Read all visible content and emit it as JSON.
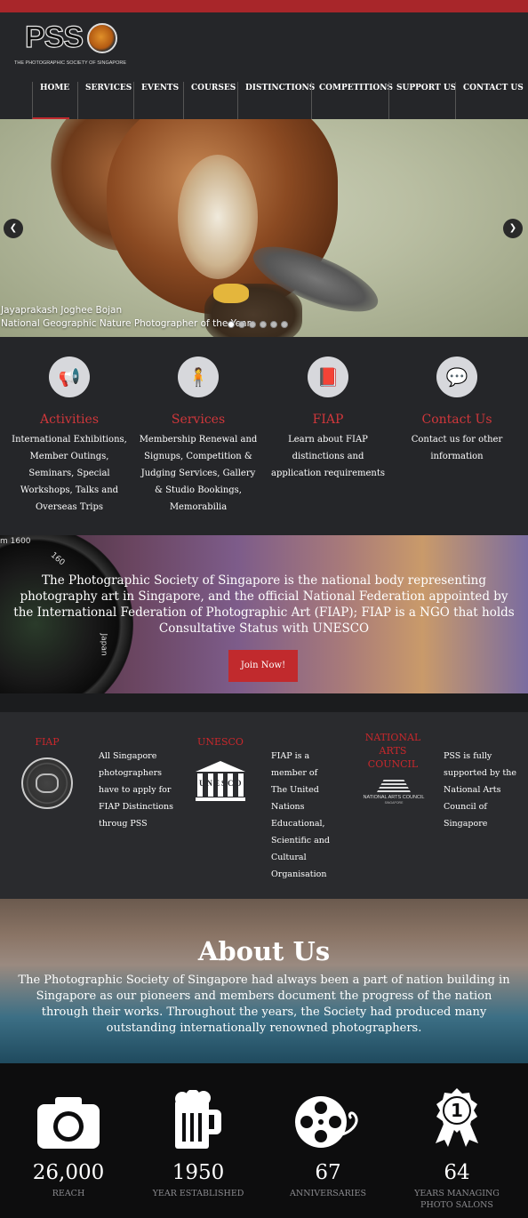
{
  "header": {
    "logo_text": "PSS",
    "logo_subtitle": "THE PHOTOGRAPHIC SOCIETY OF SINGAPORE",
    "nav": [
      {
        "label": "HOME",
        "active": true
      },
      {
        "label": "SERVICES",
        "active": false
      },
      {
        "label": "EVENTS",
        "active": false
      },
      {
        "label": "COURSES",
        "active": false
      },
      {
        "label": "DISTINCTIONS",
        "active": false
      },
      {
        "label": "COMPETITIONS",
        "active": false
      },
      {
        "label": "SUPPORT US",
        "active": false
      },
      {
        "label": "CONTACT US",
        "active": false
      }
    ]
  },
  "slider": {
    "caption_line1": "Jayaprakash Joghee Bojan",
    "caption_line2": "National Geographic Nature Photographer of the Year",
    "prev_icon": "chevron-left-icon",
    "next_icon": "chevron-right-icon",
    "slide_count": 6,
    "active_slide": 1
  },
  "features": [
    {
      "icon": "megaphone-icon",
      "glyph": "📢",
      "title": "Activities",
      "text": "International Exhibitions, Member Outings, Seminars, Special Workshops, Talks and Overseas Trips"
    },
    {
      "icon": "person-icon",
      "glyph": "🧍",
      "title": "Services",
      "text": "Membership Renewal and Signups, Competition & Judging Services, Gallery & Studio Bookings, Memorabilia"
    },
    {
      "icon": "book-icon",
      "glyph": "📕",
      "title": "FIAP",
      "text": "Learn about FIAP distinctions and application requirements"
    },
    {
      "icon": "chat-icon",
      "glyph": "💬",
      "title": "Contact Us",
      "text": "Contact us for other information"
    }
  ],
  "banner": {
    "lens_text_1": "m 1600",
    "lens_text_2": "160",
    "lens_text_3": "Japan",
    "text": "The Photographic Society of Singapore is the national body representing photography art in Singapore, and the official National Federation appointed by the International Federation of Photographic Art (FIAP); FIAP is a NGO that holds Consultative Status with UNESCO",
    "button": "Join Now!"
  },
  "partners": [
    {
      "title": "FIAP",
      "text": "All Singapore photographers have to apply for FIAP Distinctions throug PSS"
    },
    {
      "title": "UNESCO",
      "logo_word": "UNESCO",
      "text": "FIAP is a member of The United Nations Educational, Scientific and Cultural Organisation"
    },
    {
      "title": "NATIONAL ARTS COUNCIL",
      "logo_label": "NATIONAL ARTS COUNCIL",
      "logo_sublabel": "SINGAPORE",
      "text": "PSS is fully supported by the National Arts Council of Singapore"
    }
  ],
  "about": {
    "title": "About Us",
    "text": "The Photographic Society of Singapore had always been a part of nation building in Singapore as our pioneers and members document the progress of the nation through their works. Throughout the years, the Society had produced many outstanding internationally renowned photographers."
  },
  "stats": [
    {
      "icon": "camera-icon",
      "value": "26,000",
      "label": "REACH"
    },
    {
      "icon": "beer-mug-icon",
      "value": "1950",
      "label": "YEAR ESTABLISHED"
    },
    {
      "icon": "film-reel-icon",
      "value": "67",
      "label": "ANNIVERSARIES"
    },
    {
      "icon": "award-ribbon-icon",
      "badge": "1",
      "value": "64",
      "label": "YEARS MANAGING PHOTO SALONS"
    }
  ],
  "colors": {
    "accent": "#c0292e",
    "header_bg": "#252629",
    "top_bar": "#a8262a"
  }
}
